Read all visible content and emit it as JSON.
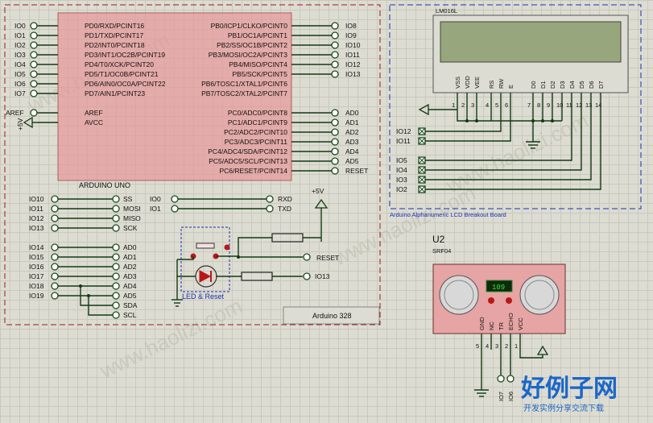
{
  "arduino": {
    "name": "ARDUINO UNO",
    "left_pins": [
      "PD0/RXD/PCINT16",
      "PD1/TXD/PCINT17",
      "PD2/INT0/PCINT18",
      "PD3/INT1/OC2B/PCINT19",
      "PD4/T0/XCK/PCINT20",
      "PD5/T1/OC0B/PCINT21",
      "PD6/AIN0/OC0A/PCINT22",
      "PD7/AIN1/PCINT23"
    ],
    "left_io": [
      "IO0",
      "IO1",
      "IO2",
      "IO3",
      "IO4",
      "IO5",
      "IO6",
      "IO7"
    ],
    "aref_pins": [
      "AREF",
      "AVCC"
    ],
    "aref_labels": [
      "AREF",
      "+5V"
    ],
    "right_pins": [
      "PB0/ICP1/CLKO/PCINT0",
      "PB1/OC1A/PCINT1",
      "PB2/SS/OC1B/PCINT2",
      "PB3/MOSI/OC2A/PCINT3",
      "PB4/MISO/PCINT4",
      "PB5/SCK/PCINT5",
      "PB6/TOSC1/XTAL1/PCINT6",
      "PB7/TOSC2/XTAL2/PCINT7"
    ],
    "right_io": [
      "IO8",
      "IO9",
      "IO10",
      "IO11",
      "IO12",
      "IO13"
    ],
    "analog_pins": [
      "PC0/ADC0/PCINT8",
      "PC1/ADC1/PCINT9",
      "PC2/ADC2/PCINT10",
      "PC3/ADC3/PCINT11",
      "PC4/ADC4/SDA/PCINT12",
      "PC5/ADC5/SCL/PCINT13",
      "PC6/RESET/PCINT14"
    ],
    "analog_io": [
      "AD0",
      "AD1",
      "AD2",
      "AD3",
      "AD4",
      "AD5",
      "RESET"
    ],
    "box_label": "Arduino 328"
  },
  "spi": {
    "left": [
      "IO10",
      "IO11",
      "IO12",
      "IO13"
    ],
    "right": [
      "SS",
      "MOSI",
      "MISO",
      "SCK"
    ]
  },
  "serial": {
    "left": [
      "IO0",
      "IO1"
    ],
    "right": [
      "RXD",
      "TXD"
    ],
    "supply": "+5V"
  },
  "analog_map": {
    "left": [
      "IO14",
      "IO15",
      "IO16",
      "IO17",
      "IO18",
      "IO19"
    ],
    "right": [
      "AD0",
      "AD1",
      "AD2",
      "AD3",
      "AD4",
      "AD5",
      "SDA",
      "SCL"
    ]
  },
  "led_reset": {
    "label": "LED & Reset",
    "reset_label": "RESET",
    "io_label": "IO13"
  },
  "lcd": {
    "part": "LM016L",
    "pin_names": [
      "VSS",
      "VDD",
      "VEE",
      "RS",
      "RW",
      "E",
      "D0",
      "D1",
      "D2",
      "D3",
      "D4",
      "D5",
      "D6",
      "D7"
    ],
    "pin_numbers": [
      "1",
      "2",
      "3",
      "4",
      "5",
      "6",
      "7",
      "8",
      "9",
      "10",
      "11",
      "12",
      "13",
      "14"
    ],
    "io": [
      "IO12",
      "IO11",
      "IO5",
      "IO4",
      "IO3",
      "IO2"
    ],
    "board_label": "Arduino Alphanumeric LCD Breakout Board"
  },
  "sensor": {
    "ref": "U2",
    "part": "SRF04",
    "display_value": "109",
    "pins": [
      "GND",
      "NC",
      "TR",
      "ECHO",
      "VCC"
    ],
    "pin_numbers": [
      "5",
      "4",
      "3",
      "2",
      "1"
    ],
    "io": [
      "IO7",
      "IO6"
    ]
  },
  "logo": {
    "main": "好例子网",
    "sub": "开发实例分享交流下载"
  },
  "watermark": "www.haolizi.com"
}
